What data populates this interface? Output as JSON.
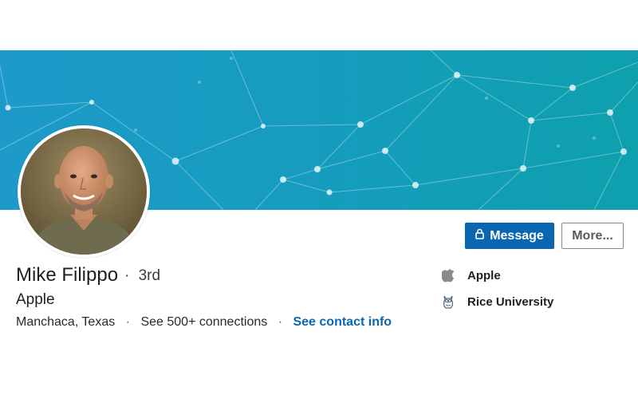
{
  "profile": {
    "name": "Mike Filippo",
    "degree": "3rd",
    "headline": "Apple",
    "location": "Manchaca, Texas",
    "connections": "See 500+ connections",
    "contact_info": "See contact info"
  },
  "actions": {
    "message_label": "Message",
    "more_label": "More..."
  },
  "sidebar": {
    "items": [
      {
        "label": "Apple",
        "icon": "apple-logo-icon"
      },
      {
        "label": "Rice University",
        "icon": "owl-icon"
      }
    ]
  },
  "colors": {
    "accent": "#0a66b0",
    "banner_start": "#1d9ac9",
    "banner_end": "#0ea0ad"
  }
}
